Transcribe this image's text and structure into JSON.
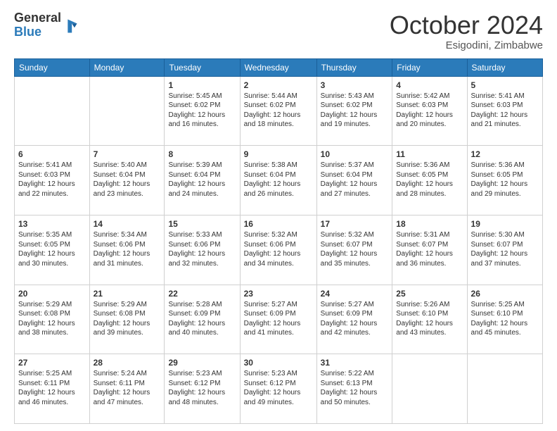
{
  "logo": {
    "general": "General",
    "blue": "Blue"
  },
  "header": {
    "month": "October 2024",
    "location": "Esigodini, Zimbabwe"
  },
  "weekdays": [
    "Sunday",
    "Monday",
    "Tuesday",
    "Wednesday",
    "Thursday",
    "Friday",
    "Saturday"
  ],
  "weeks": [
    [
      {
        "day": "",
        "info": ""
      },
      {
        "day": "",
        "info": ""
      },
      {
        "day": "1",
        "info": "Sunrise: 5:45 AM\nSunset: 6:02 PM\nDaylight: 12 hours and 16 minutes."
      },
      {
        "day": "2",
        "info": "Sunrise: 5:44 AM\nSunset: 6:02 PM\nDaylight: 12 hours and 18 minutes."
      },
      {
        "day": "3",
        "info": "Sunrise: 5:43 AM\nSunset: 6:02 PM\nDaylight: 12 hours and 19 minutes."
      },
      {
        "day": "4",
        "info": "Sunrise: 5:42 AM\nSunset: 6:03 PM\nDaylight: 12 hours and 20 minutes."
      },
      {
        "day": "5",
        "info": "Sunrise: 5:41 AM\nSunset: 6:03 PM\nDaylight: 12 hours and 21 minutes."
      }
    ],
    [
      {
        "day": "6",
        "info": "Sunrise: 5:41 AM\nSunset: 6:03 PM\nDaylight: 12 hours and 22 minutes."
      },
      {
        "day": "7",
        "info": "Sunrise: 5:40 AM\nSunset: 6:04 PM\nDaylight: 12 hours and 23 minutes."
      },
      {
        "day": "8",
        "info": "Sunrise: 5:39 AM\nSunset: 6:04 PM\nDaylight: 12 hours and 24 minutes."
      },
      {
        "day": "9",
        "info": "Sunrise: 5:38 AM\nSunset: 6:04 PM\nDaylight: 12 hours and 26 minutes."
      },
      {
        "day": "10",
        "info": "Sunrise: 5:37 AM\nSunset: 6:04 PM\nDaylight: 12 hours and 27 minutes."
      },
      {
        "day": "11",
        "info": "Sunrise: 5:36 AM\nSunset: 6:05 PM\nDaylight: 12 hours and 28 minutes."
      },
      {
        "day": "12",
        "info": "Sunrise: 5:36 AM\nSunset: 6:05 PM\nDaylight: 12 hours and 29 minutes."
      }
    ],
    [
      {
        "day": "13",
        "info": "Sunrise: 5:35 AM\nSunset: 6:05 PM\nDaylight: 12 hours and 30 minutes."
      },
      {
        "day": "14",
        "info": "Sunrise: 5:34 AM\nSunset: 6:06 PM\nDaylight: 12 hours and 31 minutes."
      },
      {
        "day": "15",
        "info": "Sunrise: 5:33 AM\nSunset: 6:06 PM\nDaylight: 12 hours and 32 minutes."
      },
      {
        "day": "16",
        "info": "Sunrise: 5:32 AM\nSunset: 6:06 PM\nDaylight: 12 hours and 34 minutes."
      },
      {
        "day": "17",
        "info": "Sunrise: 5:32 AM\nSunset: 6:07 PM\nDaylight: 12 hours and 35 minutes."
      },
      {
        "day": "18",
        "info": "Sunrise: 5:31 AM\nSunset: 6:07 PM\nDaylight: 12 hours and 36 minutes."
      },
      {
        "day": "19",
        "info": "Sunrise: 5:30 AM\nSunset: 6:07 PM\nDaylight: 12 hours and 37 minutes."
      }
    ],
    [
      {
        "day": "20",
        "info": "Sunrise: 5:29 AM\nSunset: 6:08 PM\nDaylight: 12 hours and 38 minutes."
      },
      {
        "day": "21",
        "info": "Sunrise: 5:29 AM\nSunset: 6:08 PM\nDaylight: 12 hours and 39 minutes."
      },
      {
        "day": "22",
        "info": "Sunrise: 5:28 AM\nSunset: 6:09 PM\nDaylight: 12 hours and 40 minutes."
      },
      {
        "day": "23",
        "info": "Sunrise: 5:27 AM\nSunset: 6:09 PM\nDaylight: 12 hours and 41 minutes."
      },
      {
        "day": "24",
        "info": "Sunrise: 5:27 AM\nSunset: 6:09 PM\nDaylight: 12 hours and 42 minutes."
      },
      {
        "day": "25",
        "info": "Sunrise: 5:26 AM\nSunset: 6:10 PM\nDaylight: 12 hours and 43 minutes."
      },
      {
        "day": "26",
        "info": "Sunrise: 5:25 AM\nSunset: 6:10 PM\nDaylight: 12 hours and 45 minutes."
      }
    ],
    [
      {
        "day": "27",
        "info": "Sunrise: 5:25 AM\nSunset: 6:11 PM\nDaylight: 12 hours and 46 minutes."
      },
      {
        "day": "28",
        "info": "Sunrise: 5:24 AM\nSunset: 6:11 PM\nDaylight: 12 hours and 47 minutes."
      },
      {
        "day": "29",
        "info": "Sunrise: 5:23 AM\nSunset: 6:12 PM\nDaylight: 12 hours and 48 minutes."
      },
      {
        "day": "30",
        "info": "Sunrise: 5:23 AM\nSunset: 6:12 PM\nDaylight: 12 hours and 49 minutes."
      },
      {
        "day": "31",
        "info": "Sunrise: 5:22 AM\nSunset: 6:13 PM\nDaylight: 12 hours and 50 minutes."
      },
      {
        "day": "",
        "info": ""
      },
      {
        "day": "",
        "info": ""
      }
    ]
  ]
}
